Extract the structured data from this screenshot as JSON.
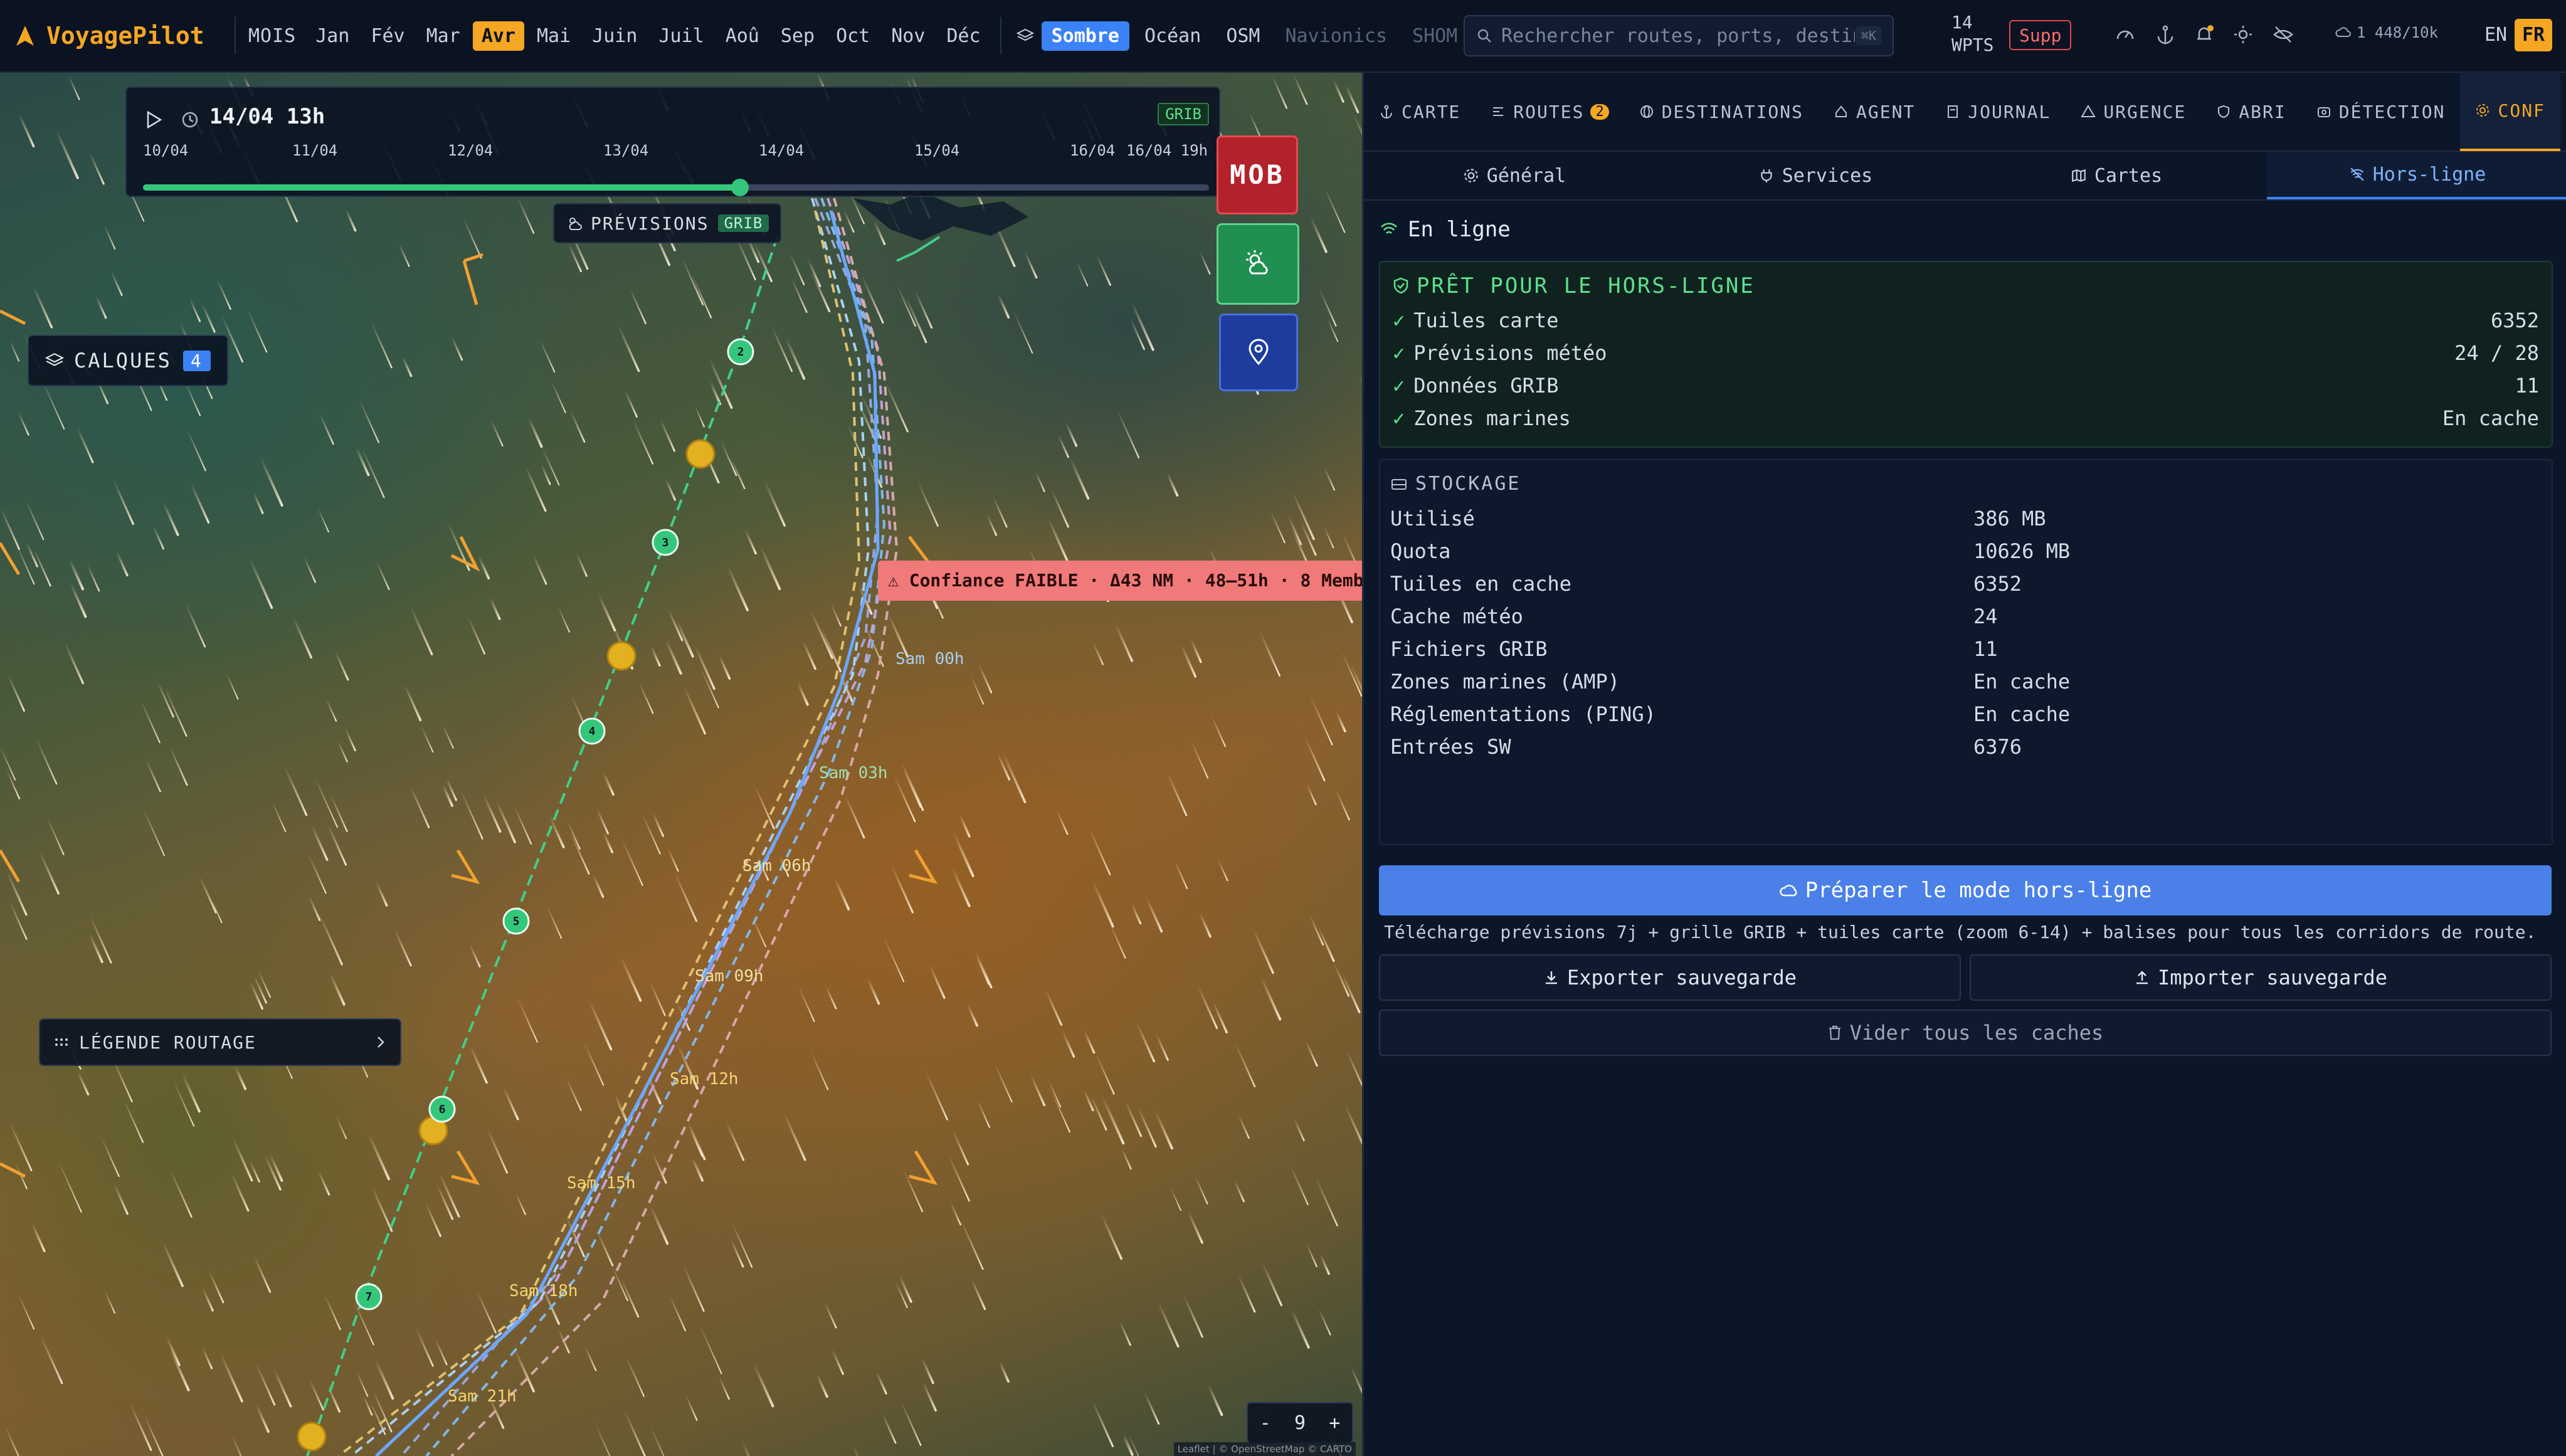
{
  "app": {
    "name": "VoyagePilot"
  },
  "months": {
    "label": "MOIS",
    "items": [
      "Jan",
      "Fév",
      "Mar",
      "Avr",
      "Mai",
      "Juin",
      "Juil",
      "Aoû",
      "Sep",
      "Oct",
      "Nov",
      "Déc"
    ],
    "active": "Avr"
  },
  "basemaps": {
    "items": [
      "Sombre",
      "Océan",
      "OSM",
      "Navionics",
      "SHOM"
    ],
    "active": "Sombre",
    "disabled": [
      "Navionics",
      "SHOM"
    ]
  },
  "search": {
    "placeholder": "Rechercher routes, ports, destin",
    "shortcut": "⌘K"
  },
  "waypoints": {
    "count": "14",
    "label": "WPTS"
  },
  "supp_label": "Supp",
  "quota_indicator": "1 448/10k",
  "languages": {
    "en": "EN",
    "fr": "FR",
    "active": "FR"
  },
  "timeline": {
    "current": "14/04 13h",
    "badge": "GRIB",
    "labels": [
      "10/04",
      "11/04",
      "12/04",
      "13/04",
      "14/04",
      "15/04",
      "16/04",
      "16/04 19h"
    ],
    "progress": 0.56
  },
  "map": {
    "mob_label": "MOB",
    "previsions": {
      "label": "PRÉVISIONS",
      "badge": "GRIB"
    },
    "layers": {
      "label": "CALQUES",
      "count": "4"
    },
    "legend_label": "LÉGENDE ROUTAGE",
    "confidence_banner": "⚠ Confiance FAIBLE · Δ43 NM · 48–51h · 8 Memb",
    "waypoint_numbers": [
      "2",
      "3",
      "4",
      "5",
      "6",
      "7"
    ],
    "time_labels": [
      "Sam 00h",
      "Sam 03h",
      "Sam 06h",
      "Sam 09h",
      "Sam 12h",
      "Sam 15h",
      "Sam 18h",
      "Sam 21h"
    ],
    "zoom": {
      "minus": "-",
      "level": "9",
      "plus": "+"
    },
    "attribution": "Leaflet | © OpenStreetMap © CARTO"
  },
  "tabs": [
    {
      "label": "CARTE",
      "icon": "anchor-icon"
    },
    {
      "label": "ROUTES",
      "icon": "route-icon",
      "badge": "2"
    },
    {
      "label": "DESTINATIONS",
      "icon": "globe-icon"
    },
    {
      "label": "AGENT",
      "icon": "agent-icon"
    },
    {
      "label": "JOURNAL",
      "icon": "journal-icon"
    },
    {
      "label": "URGENCE",
      "icon": "warning-icon"
    },
    {
      "label": "ABRI",
      "icon": "shield-icon"
    },
    {
      "label": "DÉTECTION",
      "icon": "radar-icon"
    },
    {
      "label": "CONF",
      "icon": "gear-icon",
      "active": true
    }
  ],
  "subtabs": [
    {
      "label": "Général",
      "icon": "gear-icon"
    },
    {
      "label": "Services",
      "icon": "plug-icon"
    },
    {
      "label": "Cartes",
      "icon": "map-icon"
    },
    {
      "label": "Hors-ligne",
      "icon": "wifi-off-icon",
      "active": true
    }
  ],
  "status": {
    "online": "En ligne"
  },
  "offline_ready": {
    "title": "PRÊT POUR LE HORS-LIGNE",
    "rows": [
      {
        "label": "Tuiles carte",
        "value": "6352"
      },
      {
        "label": "Prévisions météo",
        "value": "24 / 28"
      },
      {
        "label": "Données GRIB",
        "value": "11"
      },
      {
        "label": "Zones marines",
        "value": "En cache"
      }
    ]
  },
  "storage": {
    "title": "STOCKAGE",
    "rows": [
      {
        "label": "Utilisé",
        "value": "386 MB"
      },
      {
        "label": "Quota",
        "value": "10626 MB"
      },
      {
        "label": "Tuiles en cache",
        "value": "6352"
      },
      {
        "label": "Cache météo",
        "value": "24"
      },
      {
        "label": "Fichiers GRIB",
        "value": "11"
      },
      {
        "label": "Zones marines (AMP)",
        "value": "En cache"
      },
      {
        "label": "Réglementations (PING)",
        "value": "En cache"
      },
      {
        "label": "Entrées SW",
        "value": "6376"
      }
    ]
  },
  "actions": {
    "prepare": "Préparer le mode hors-ligne",
    "prepare_desc": "Télécharge prévisions 7j + grille GRIB + tuiles carte (zoom 6-14) + balises pour tous les corridors de route.",
    "export": "Exporter sauvegarde",
    "import": "Importer sauvegarde",
    "clear": "Vider tous les caches"
  },
  "colors": {
    "accent": "#f5a623",
    "primary": "#3b82f6",
    "success": "#34c77b",
    "danger": "#b3222a"
  }
}
